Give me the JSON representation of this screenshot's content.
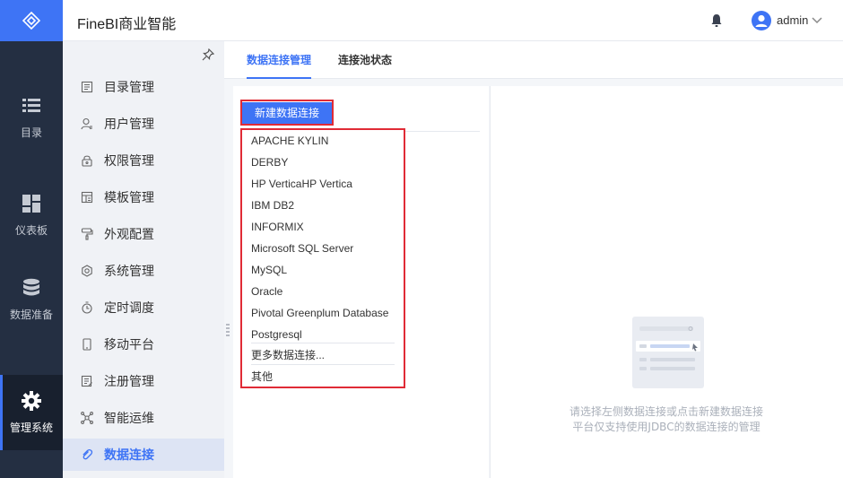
{
  "app": {
    "title": "FineBI商业智能"
  },
  "header": {
    "user_name": "admin"
  },
  "rail": {
    "items": [
      {
        "label": "目录",
        "icon": "list-icon"
      },
      {
        "label": "仪表板",
        "icon": "dashboard-icon"
      },
      {
        "label": "数据准备",
        "icon": "database-icon"
      },
      {
        "label": "管理系统",
        "icon": "gear-icon",
        "active": true
      }
    ]
  },
  "menu": {
    "items": [
      {
        "label": "目录管理",
        "icon": "directory-icon"
      },
      {
        "label": "用户管理",
        "icon": "user-icon"
      },
      {
        "label": "权限管理",
        "icon": "lock-icon"
      },
      {
        "label": "模板管理",
        "icon": "template-icon"
      },
      {
        "label": "外观配置",
        "icon": "paint-roller-icon"
      },
      {
        "label": "系统管理",
        "icon": "settings-icon"
      },
      {
        "label": "定时调度",
        "icon": "timer-icon"
      },
      {
        "label": "移动平台",
        "icon": "mobile-icon"
      },
      {
        "label": "注册管理",
        "icon": "register-icon"
      },
      {
        "label": "智能运维",
        "icon": "network-icon"
      },
      {
        "label": "数据连接",
        "icon": "link-icon",
        "active": true
      }
    ]
  },
  "tabs": [
    {
      "label": "数据连接管理",
      "active": true
    },
    {
      "label": "连接池状态"
    }
  ],
  "toolbar": {
    "new_connection_label": "新建数据连接"
  },
  "dropdown": {
    "items": [
      "APACHE KYLIN",
      "DERBY",
      "HP VerticaHP Vertica",
      "IBM DB2",
      "INFORMIX",
      "Microsoft SQL Server",
      "MySQL",
      "Oracle",
      "Pivotal Greenplum Database",
      "Postgresql"
    ],
    "more_label": "更多数据连接...",
    "other_label": "其他"
  },
  "empty_state": {
    "line1": "请选择左侧数据连接或点击新建数据连接",
    "line2": "平台仅支持使用JDBC的数据连接的管理"
  },
  "colors": {
    "accent": "#3e74f5",
    "rail_bg": "#242f42",
    "highlight_border": "#e02b36"
  }
}
